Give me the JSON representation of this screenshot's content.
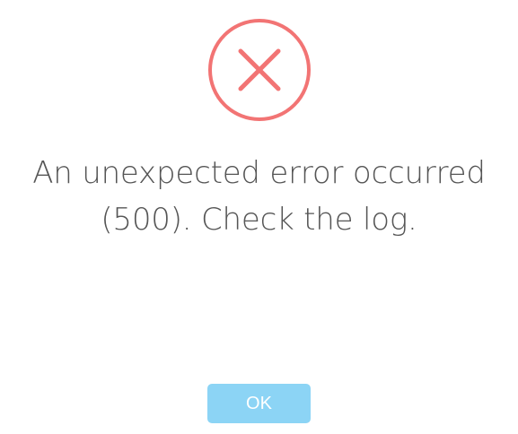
{
  "dialog": {
    "icon": "error-x-icon",
    "message_line_1": "An unexpected error occurred",
    "message_line_2": "(500). Check the log.",
    "ok_label": "OK"
  },
  "colors": {
    "error_accent": "#f27474",
    "text": "#555555",
    "button_bg": "#8cd4f5",
    "button_text": "#ffffff",
    "background": "#ffffff"
  }
}
